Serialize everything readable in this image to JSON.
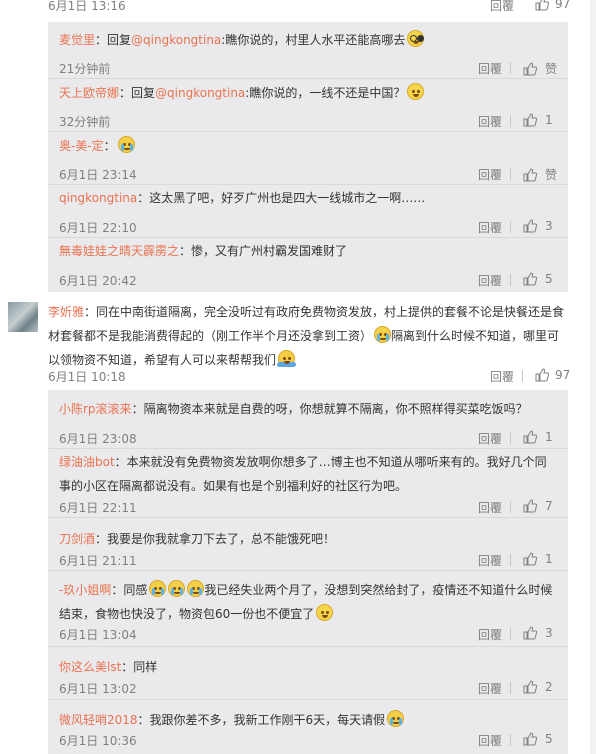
{
  "top": {
    "time": "6月1日 13:16",
    "reply_label": "回覆",
    "like_count": "97"
  },
  "thread1": [
    {
      "user": "麦觉里",
      "text_prefix": "：回复",
      "mention": "@qingkongtina",
      "text": ":瞧你说的，村里人水平还能高哪去",
      "emoji": "glasses-emoji",
      "time": "21分钟前",
      "reply_label": "回覆",
      "like_label": "赞"
    },
    {
      "user": "天上欧帝娜",
      "text_prefix": "：回复",
      "mention": "@qingkongtina",
      "text": ":瞧你说的，一线不还是中国？",
      "emoji": "smirk-emoji",
      "time": "32分钟前",
      "reply_label": "回覆",
      "like_label": "1"
    },
    {
      "user": "奥-美-定",
      "text_prefix": "：",
      "mention": "",
      "text": "",
      "emoji": "cry-emoji",
      "time": "6月1日 23:14",
      "reply_label": "回覆",
      "like_label": "赞"
    },
    {
      "user": "qingkongtina",
      "text_prefix": "：",
      "mention": "",
      "text": "这太黑了吧，好歹广州也是四大一线城市之一啊……",
      "emoji": "",
      "time": "6月1日 22:10",
      "reply_label": "回覆",
      "like_label": "3"
    },
    {
      "user": "無毒娃娃之晴天霹雳之",
      "text_prefix": "：",
      "mention": "",
      "text": "惨，又有广州村霸发国难财了",
      "emoji": "",
      "time": "6月1日 20:42",
      "reply_label": "回覆",
      "like_label": "5"
    }
  ],
  "main": {
    "user": "李妡雅",
    "text1": "：同在中南街道隔离，完全没听过有政府免费物资发放，村上提供的套餐不论是快餐还是食",
    "text2": "材套餐都不是我能消费得起的（刚工作半个月还没拿到工资）",
    "text3": "隔离到什么时候不知道，哪里可",
    "text4": "以领物资不知道，希望有人可以来帮帮我们",
    "time": "6月1日 10:18",
    "reply_label": "回覆",
    "like_count": "97"
  },
  "thread2": [
    {
      "user": "小陈rp滚滚来",
      "lines": [
        "：隔离物资本来就是自费的呀，你想就算不隔离，你不照样得买菜吃饭吗？"
      ],
      "time": "6月1日 23:08",
      "reply_label": "回覆",
      "like_label": "1"
    },
    {
      "user": "绿油油bot",
      "lines": [
        "：本来就没有免费物资发放啊你想多了…博主也不知道从哪听来有的。我好几个同",
        "事的小区在隔离都说没有。如果有也是个别福利好的社区行为吧。"
      ],
      "time": "6月1日 22:11",
      "reply_label": "回覆",
      "like_label": "7"
    },
    {
      "user": "刀剑酒",
      "lines": [
        "：我要是你我就拿刀下去了，总不能饿死吧！"
      ],
      "time": "6月1日 21:11",
      "reply_label": "回覆",
      "like_label": "1"
    },
    {
      "user": "-玖小姐啊",
      "lines": [
        "：同感",
        "我已经失业两个月了，没想到突然给封了，疫情还不知道什么时候",
        "结束，食物也快没了，物资包60一份也不便宜了"
      ],
      "time": "6月1日 13:04",
      "reply_label": "回覆",
      "like_label": "3"
    },
    {
      "user": "你这么美lst",
      "lines": [
        "：同样"
      ],
      "time": "6月1日 13:02",
      "reply_label": "回覆",
      "like_label": "2"
    },
    {
      "user": "微风轻哨2018",
      "lines": [
        "：我跟你差不多，我新工作刚干6天，每天请假"
      ],
      "time": "6月1日 10:36",
      "reply_label": "回覆",
      "like_label": "5"
    }
  ],
  "colors": {
    "username": "#eb7350",
    "meta": "#808080",
    "panel": "#eaeaec",
    "text": "#333333"
  }
}
